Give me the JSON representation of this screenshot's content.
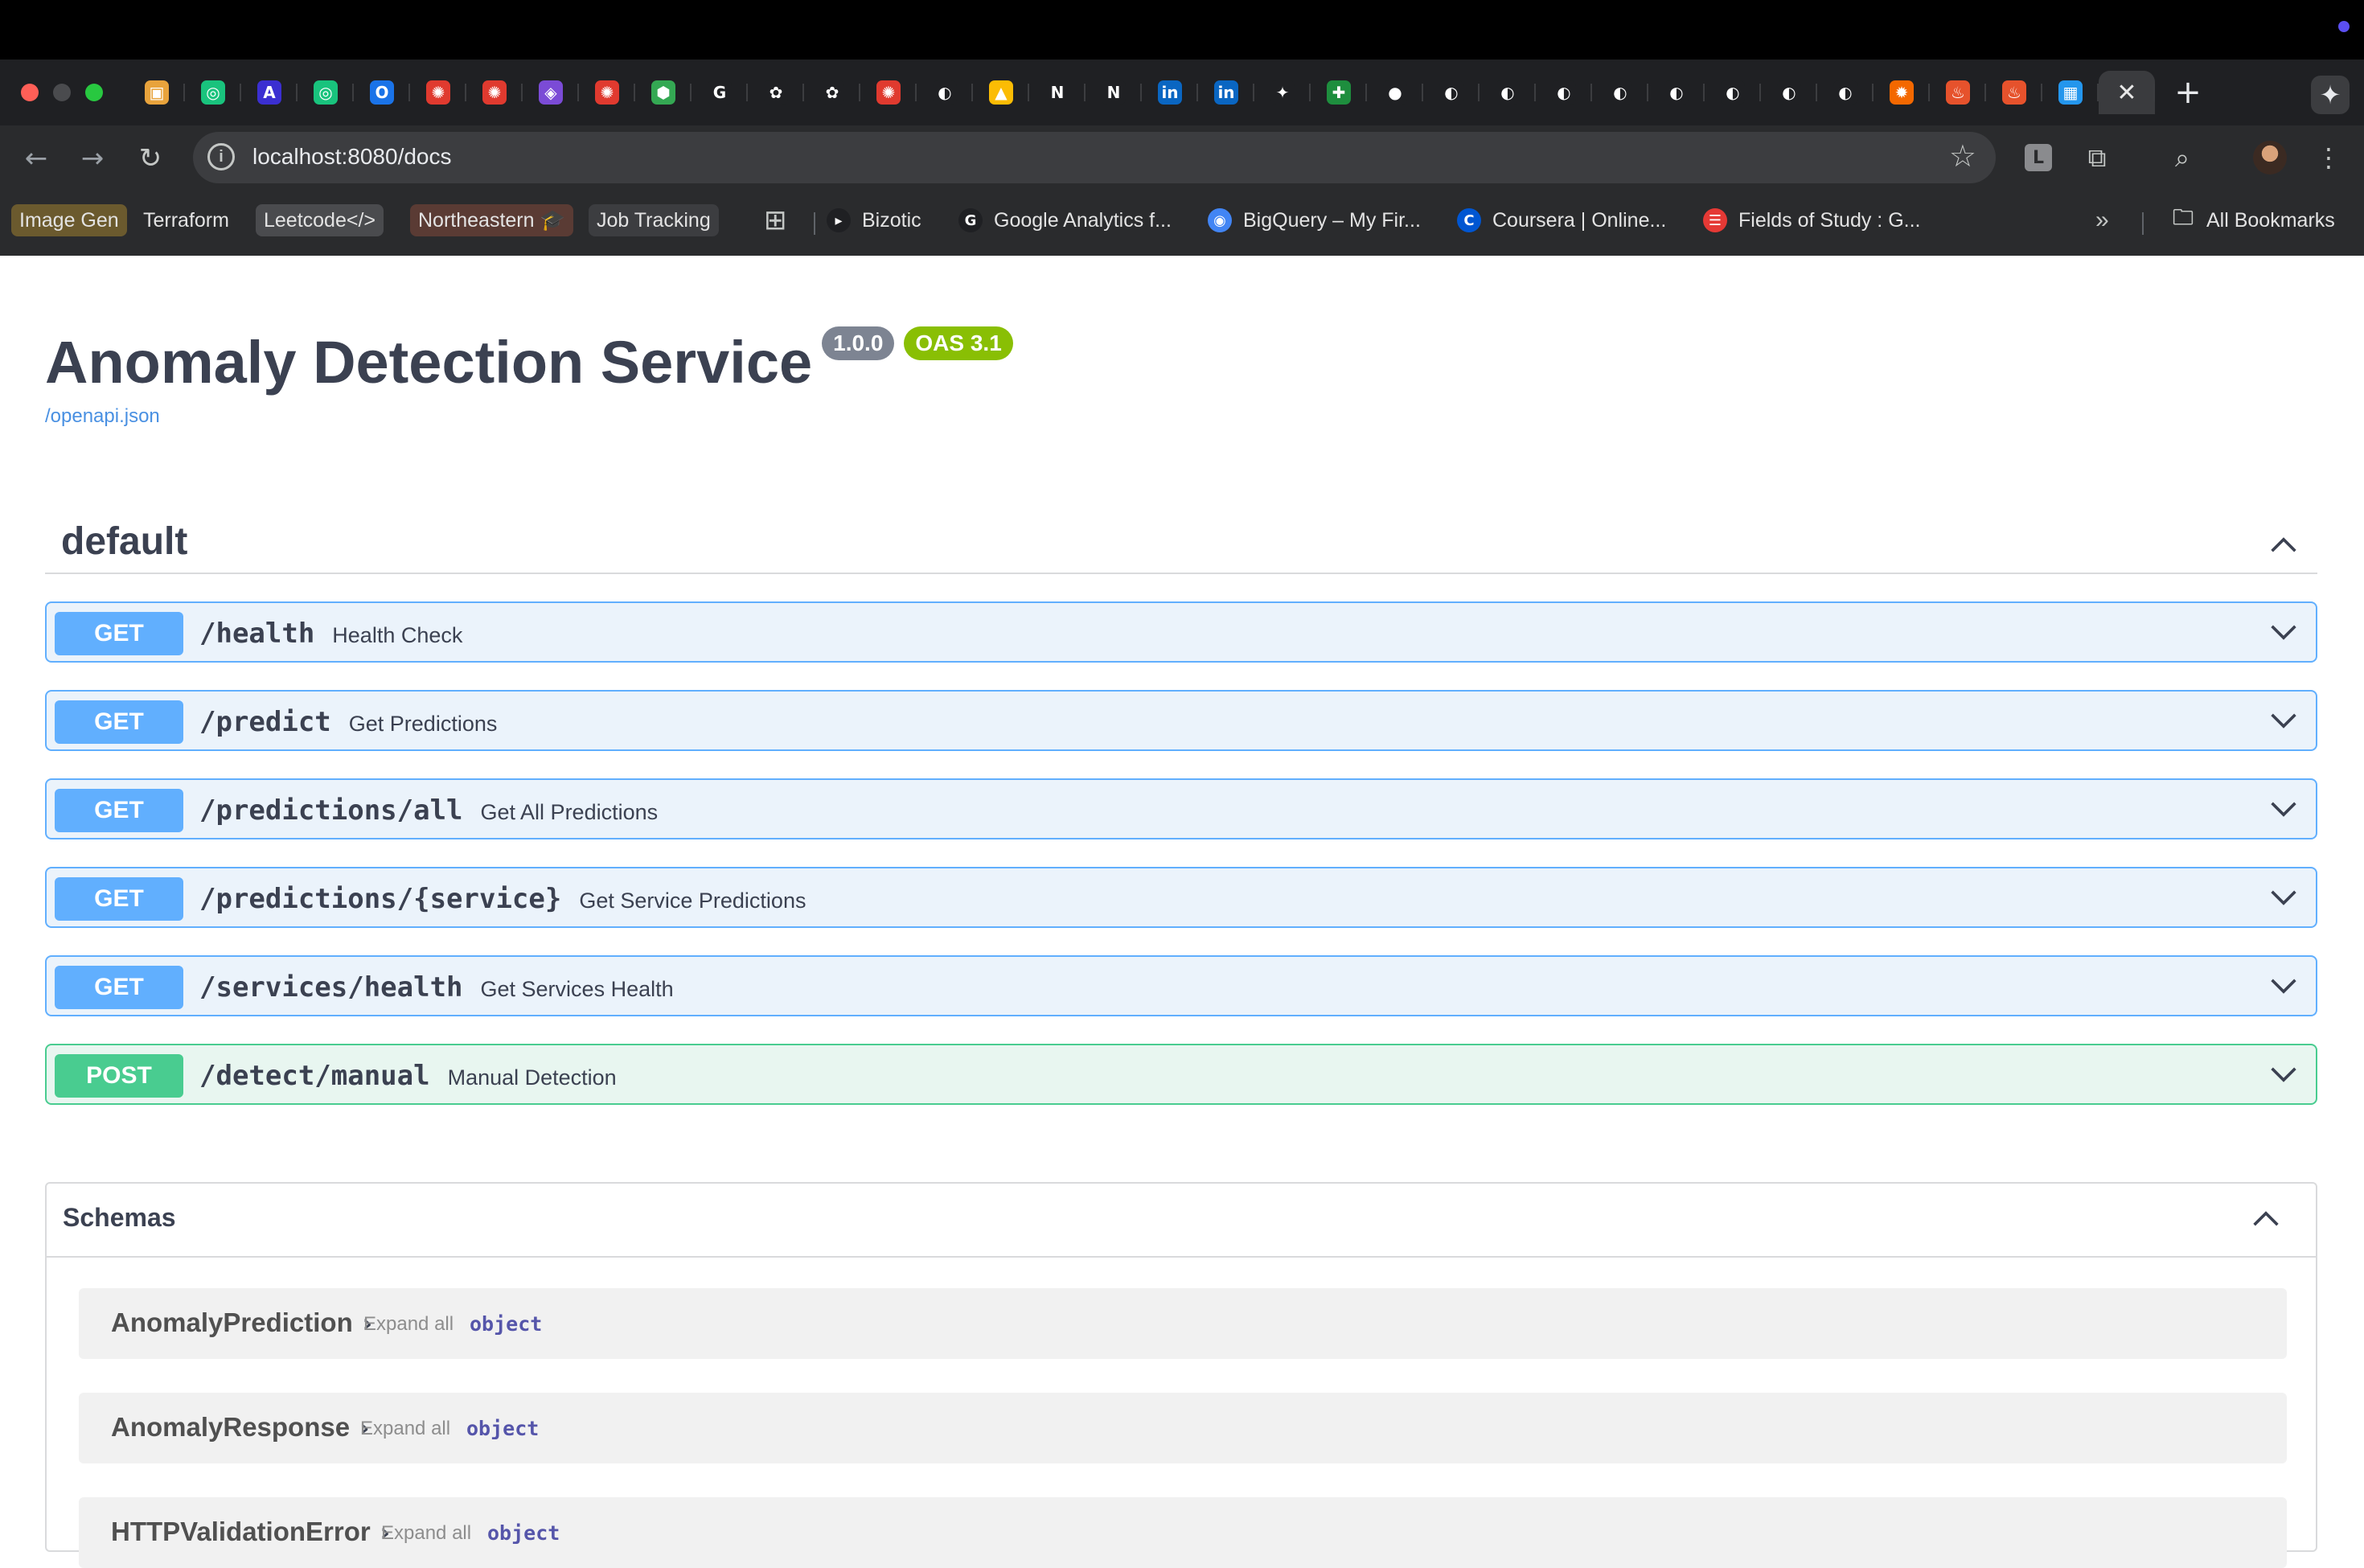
{
  "browser": {
    "url": "localhost:8080/docs",
    "tabs": [
      {
        "icon": "box-icon",
        "color": "#e8a33c",
        "glyph": "▣"
      },
      {
        "icon": "chatgpt-green-icon",
        "color": "#19c37d",
        "glyph": "◎"
      },
      {
        "icon": "a-icon",
        "color": "#3b2fd1",
        "glyph": "A"
      },
      {
        "icon": "chatgpt-green-icon",
        "color": "#19c37d",
        "glyph": "◎"
      },
      {
        "icon": "outlook-icon",
        "color": "#1a73e8",
        "glyph": "O"
      },
      {
        "icon": "canvas-icon",
        "color": "#e03a2f",
        "glyph": "✺"
      },
      {
        "icon": "canvas-icon",
        "color": "#e03a2f",
        "glyph": "✺"
      },
      {
        "icon": "shield-icon",
        "color": "#7b4bd6",
        "glyph": "◈"
      },
      {
        "icon": "canvas-icon",
        "color": "#e03a2f",
        "glyph": "✺"
      },
      {
        "icon": "gemini-hex-icon",
        "color": "#34a853",
        "glyph": "⬢"
      },
      {
        "icon": "google-icon",
        "color": "#1f2023",
        "glyph": "G"
      },
      {
        "icon": "openai-icon",
        "color": "#1f2023",
        "glyph": "✿"
      },
      {
        "icon": "openai-icon",
        "color": "#1f2023",
        "glyph": "✿"
      },
      {
        "icon": "canvas-icon",
        "color": "#e03a2f",
        "glyph": "✺"
      },
      {
        "icon": "globe-icon",
        "color": "#1f2023",
        "glyph": "◐"
      },
      {
        "icon": "google-drive-icon",
        "color": "#fbbc04",
        "glyph": "▲"
      },
      {
        "icon": "northeastern-icon",
        "color": "#1f2023",
        "glyph": "N"
      },
      {
        "icon": "northeastern-icon",
        "color": "#1f2023",
        "glyph": "N"
      },
      {
        "icon": "linkedin-icon",
        "color": "#0a66c2",
        "glyph": "in"
      },
      {
        "icon": "linkedin-icon",
        "color": "#0a66c2",
        "glyph": "in"
      },
      {
        "icon": "bird-icon",
        "color": "#1f2023",
        "glyph": "✦"
      },
      {
        "icon": "sheets-plus-icon",
        "color": "#1e8e3e",
        "glyph": "✚"
      },
      {
        "icon": "github-icon",
        "color": "#1f2023",
        "glyph": "●"
      },
      {
        "icon": "globe-icon",
        "color": "#1f2023",
        "glyph": "◐"
      },
      {
        "icon": "globe-icon",
        "color": "#1f2023",
        "glyph": "◐"
      },
      {
        "icon": "globe-icon",
        "color": "#1f2023",
        "glyph": "◐"
      },
      {
        "icon": "globe-icon",
        "color": "#1f2023",
        "glyph": "◐"
      },
      {
        "icon": "globe-icon",
        "color": "#1f2023",
        "glyph": "◐"
      },
      {
        "icon": "globe-icon",
        "color": "#1f2023",
        "glyph": "◐"
      },
      {
        "icon": "globe-icon",
        "color": "#1f2023",
        "glyph": "◐"
      },
      {
        "icon": "globe-icon",
        "color": "#1f2023",
        "glyph": "◐"
      },
      {
        "icon": "grafana-icon",
        "color": "#f46800",
        "glyph": "✹"
      },
      {
        "icon": "prometheus-icon",
        "color": "#e6522c",
        "glyph": "♨"
      },
      {
        "icon": "prometheus-icon",
        "color": "#e6522c",
        "glyph": "♨"
      },
      {
        "icon": "docker-icon",
        "color": "#2496ed",
        "glyph": "▦"
      },
      {
        "icon": "close-icon",
        "color": "#3a3b3e",
        "glyph": "✕",
        "active": true
      }
    ],
    "bookmarks": [
      {
        "label": "Image Gen",
        "style": "chip",
        "bg": "#6b5a2e"
      },
      {
        "label": "Terraform",
        "style": "plain"
      },
      {
        "label": "Leetcode</>",
        "style": "chip",
        "bg": "#4a4b4e"
      },
      {
        "label": "Northeastern 🎓",
        "style": "chip",
        "bg": "#5a3b34"
      },
      {
        "label": "Job Tracking",
        "style": "chip",
        "bg": "#3c3d40"
      },
      {
        "label": "Bizotic",
        "icon": "bizotic-icon",
        "fav_color": "#1f2023",
        "fav_glyph": "▸"
      },
      {
        "label": "Google Analytics f...",
        "icon": "google-icon",
        "fav_color": "#1f2023",
        "fav_glyph": "G"
      },
      {
        "label": "BigQuery – My Fir...",
        "icon": "bigquery-icon",
        "fav_color": "#4285f4",
        "fav_glyph": "◉"
      },
      {
        "label": "Coursera | Online...",
        "icon": "coursera-icon",
        "fav_color": "#0056d2",
        "fav_glyph": "C"
      },
      {
        "label": "Fields of Study : G...",
        "icon": "fields-icon",
        "fav_color": "#e53935",
        "fav_glyph": "☰"
      }
    ],
    "all_bookmarks": "All Bookmarks",
    "apps_icon": "grid-icon"
  },
  "page": {
    "title": "Anomaly Detection Service",
    "version": "1.0.0",
    "oas": "OAS 3.1",
    "spec_link": "/openapi.json",
    "section": "default",
    "operations": [
      {
        "method": "GET",
        "path": "/health",
        "summary": "Health Check"
      },
      {
        "method": "GET",
        "path": "/predict",
        "summary": "Get Predictions"
      },
      {
        "method": "GET",
        "path": "/predictions/all",
        "summary": "Get All Predictions"
      },
      {
        "method": "GET",
        "path": "/predictions/{service}",
        "summary": "Get Service Predictions"
      },
      {
        "method": "GET",
        "path": "/services/health",
        "summary": "Get Services Health"
      },
      {
        "method": "POST",
        "path": "/detect/manual",
        "summary": "Manual Detection"
      }
    ],
    "schemas_title": "Schemas",
    "schemas": [
      {
        "name": "AnomalyPrediction",
        "expand": "Expand all",
        "type": "object"
      },
      {
        "name": "AnomalyResponse",
        "expand": "Expand all",
        "type": "object"
      },
      {
        "name": "HTTPValidationError",
        "expand": "Expand all",
        "type": "object"
      }
    ]
  },
  "colors": {
    "get": "#61affe",
    "post": "#49cc90",
    "version_badge": "#7d8492",
    "oas_badge": "#89bf04"
  }
}
